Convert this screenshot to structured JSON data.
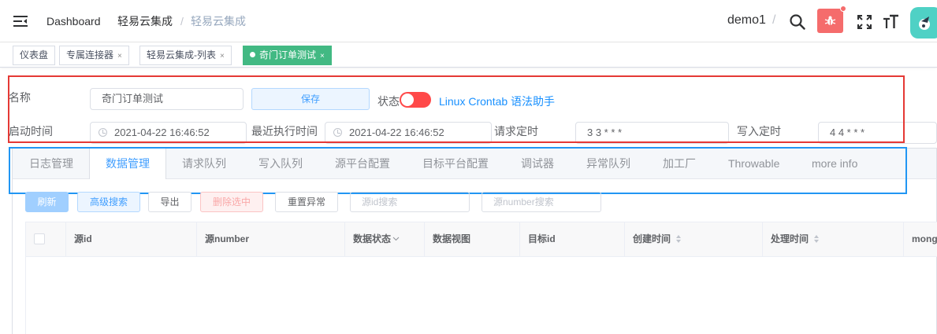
{
  "breadcrumb": [
    "Dashboard",
    "轻易云集成",
    "轻易云集成"
  ],
  "breadcrumb_sep": "/",
  "user": {
    "name": "demo1",
    "sep": "/"
  },
  "tags": [
    {
      "label": "仪表盘",
      "closable": false,
      "active": false
    },
    {
      "label": "专属连接器",
      "closable": true,
      "active": false
    },
    {
      "label": "轻易云集成-列表",
      "closable": true,
      "active": false
    },
    {
      "label": "奇门订单测试",
      "closable": true,
      "active": true
    }
  ],
  "close_glyph": "×",
  "form": {
    "name_label": "名称",
    "name_value": "奇门订单测试",
    "save_label": "保存",
    "status_label": "状态",
    "status_on": false,
    "crontab_link": "Linux Crontab 语法助手",
    "start_label": "启动时间",
    "start_value": "2021-04-22 16:46:52",
    "last_run_label": "最近执行时间",
    "last_run_value": "2021-04-22 16:46:52",
    "request_cron_label": "请求定时",
    "request_cron_value": "3 3 * * *",
    "write_cron_label": "写入定时",
    "write_cron_value": "4 4 * * *"
  },
  "tabs": [
    "日志管理",
    "数据管理",
    "请求队列",
    "写入队列",
    "源平台配置",
    "目标平台配置",
    "调试器",
    "异常队列",
    "加工厂",
    "Throwable",
    "more info"
  ],
  "active_tab": 1,
  "toolbar": {
    "refresh": "刷新",
    "advanced_search": "高级搜索",
    "export": "导出",
    "delete_selected": "删除选中",
    "reset_errors": "重置异常",
    "source_id_placeholder": "源id搜索",
    "source_number_placeholder": "源number搜索"
  },
  "table": {
    "columns": [
      "源id",
      "源number",
      "数据状态",
      "数据视图",
      "目标id",
      "创建时间",
      "处理时间",
      "mong"
    ]
  },
  "colors": {
    "accent": "#409eff",
    "success": "#42b983",
    "danger": "#f56c6c",
    "switch_off": "#ff4949"
  }
}
